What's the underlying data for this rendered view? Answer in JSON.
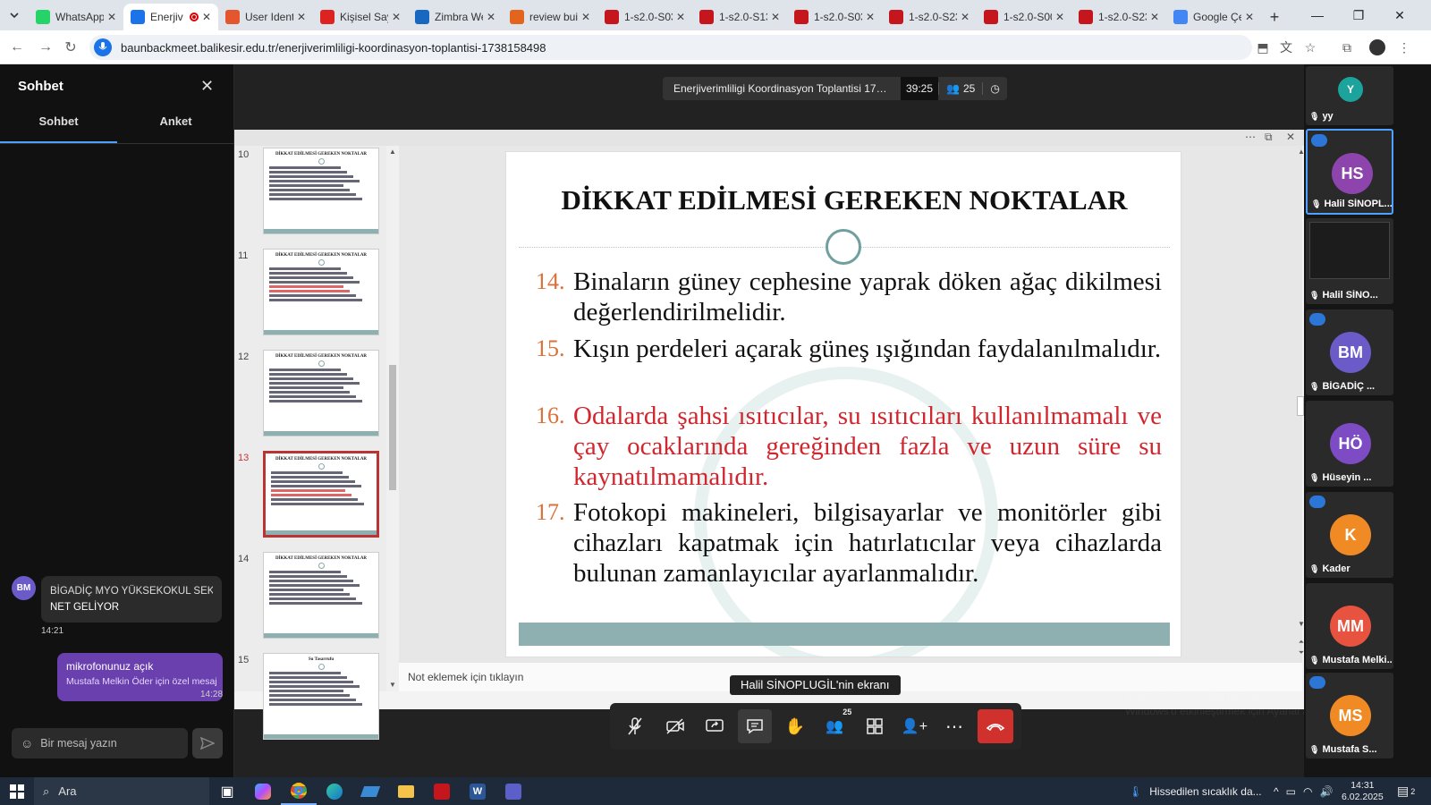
{
  "browser": {
    "tabs": [
      {
        "label": "WhatsApp",
        "icon": "whatsapp-icon",
        "color": "#25d366",
        "active": false
      },
      {
        "label": "Enerjiv",
        "icon": "bbb-icon",
        "color": "#1a73e8",
        "active": true,
        "recording": true
      },
      {
        "label": "User Ident",
        "icon": "tag-icon",
        "color": "#e4572e",
        "active": false
      },
      {
        "label": "Kişisel Sayf",
        "icon": "check-icon",
        "color": "#d22",
        "active": false
      },
      {
        "label": "Zimbra We",
        "icon": "zimbra-icon",
        "color": "#1867c0",
        "active": false
      },
      {
        "label": "review buil",
        "icon": "e-icon",
        "color": "#e3641c",
        "active": false
      },
      {
        "label": "1-s2.0-S03",
        "icon": "pdf-icon",
        "color": "#c4161c",
        "active": false
      },
      {
        "label": "1-s2.0-S13",
        "icon": "pdf-icon",
        "color": "#c4161c",
        "active": false
      },
      {
        "label": "1-s2.0-S03",
        "icon": "pdf-icon",
        "color": "#c4161c",
        "active": false
      },
      {
        "label": "1-s2.0-S23",
        "icon": "pdf-icon",
        "color": "#c4161c",
        "active": false
      },
      {
        "label": "1-s2.0-S00",
        "icon": "pdf-icon",
        "color": "#c4161c",
        "active": false
      },
      {
        "label": "1-s2.0-S23",
        "icon": "pdf-icon",
        "color": "#c4161c",
        "active": false
      },
      {
        "label": "Google Çe",
        "icon": "translate-icon",
        "color": "#4285f4",
        "active": false
      }
    ],
    "url": "baunbackmeet.balikesir.edu.tr/enerjiverimliligi-koordinasyon-toplantisi-1738158498"
  },
  "chat": {
    "title": "Sohbet",
    "tabs": [
      "Sohbet",
      "Anket"
    ],
    "messages": [
      {
        "avatar": "BM",
        "sender": "BİGADİÇ MYO YÜKSEKOKUL SEK...",
        "text": "NET GELİYOR",
        "time": "14:21"
      },
      {
        "text": "mikrofonunuz açık",
        "note": "Mustafa Melkin Öder için özel mesaj",
        "time": "14:28"
      }
    ],
    "input_placeholder": "Bir mesaj yazın"
  },
  "meeting": {
    "title": "Enerjiverimliligi Koordinasyon Toplantisi 173...",
    "elapsed": "39:25",
    "participant_count": "25",
    "presenter_label": "Halil SİNOPLUGİL'nin ekranı",
    "control_badge": "25",
    "os_watermark": [
      "Windows'u Etkinleştir",
      "Windows'u etkinleştirmek için Ayarlar'a gidin."
    ]
  },
  "presentation": {
    "thumb_numbers": [
      "10",
      "11",
      "12",
      "13",
      "14",
      "15"
    ],
    "thumb_titles": [
      "DİKKAT EDİLMESİ GEREKEN NOKTALAR",
      "DİKKAT EDİLMESİ GEREKEN NOKTALAR",
      "DİKKAT EDİLMESİ GEREKEN NOKTALAR",
      "DİKKAT EDİLMESİ GEREKEN NOKTALAR",
      "DİKKAT EDİLMESİ GEREKEN NOKTALAR",
      "Su Tasarrufu"
    ],
    "selected_slide": "13",
    "slide_title": "DİKKAT EDİLMESİ GEREKEN NOKTALAR",
    "items": [
      {
        "num": "14.",
        "text": "Binaların güney cephesine yaprak döken ağaç dikilmesi değerlendirilmelidir.",
        "red": false
      },
      {
        "num": "15.",
        "text": "Kışın perdeleri açarak güneş ışığından faydalanılmalıdır.",
        "red": false
      },
      {
        "num": "16.",
        "text": "Odalarda şahsi ısıtıcılar, su ısıtıcıları kullanılmamalı ve çay ocaklarında gereğinden fazla ve uzun süre su kaynatılmamalıdır.",
        "red": true
      },
      {
        "num": "17.",
        "text": "Fotokopi makineleri, bilgisayarlar ve monitörler gibi cihazları kapatmak için hatırlatıcılar veya cihazlarda bulunan zamanlayıcılar ayarlanmalıdır.",
        "red": false
      }
    ],
    "notes_placeholder": "Not eklemek için tıklayın"
  },
  "participants": [
    {
      "initials": "Y",
      "name": "yy",
      "color": "#1ba39c",
      "small": true
    },
    {
      "initials": "HS",
      "name": "Halil SİNOPL...",
      "color": "#8e44ad",
      "highlight": true
    },
    {
      "initials": "",
      "name": "Halil SİNO...",
      "color": "#333",
      "screen": true
    },
    {
      "initials": "BM",
      "name": "BİGADİÇ ...",
      "color": "#6b5bc9"
    },
    {
      "initials": "HÖ",
      "name": "Hüseyin ...",
      "color": "#7d4bc4"
    },
    {
      "initials": "K",
      "name": "Kader",
      "color": "#f08a24"
    },
    {
      "initials": "MM",
      "name": "Mustafa Melki...",
      "color": "#e8533f"
    },
    {
      "initials": "MS",
      "name": "Mustafa S...",
      "color": "#f08a24"
    }
  ],
  "taskbar": {
    "search": "Ara",
    "weather": "Hissedilen sıcaklık da...",
    "time": "14:31",
    "date": "6.02.2025",
    "notification_count": "2"
  }
}
